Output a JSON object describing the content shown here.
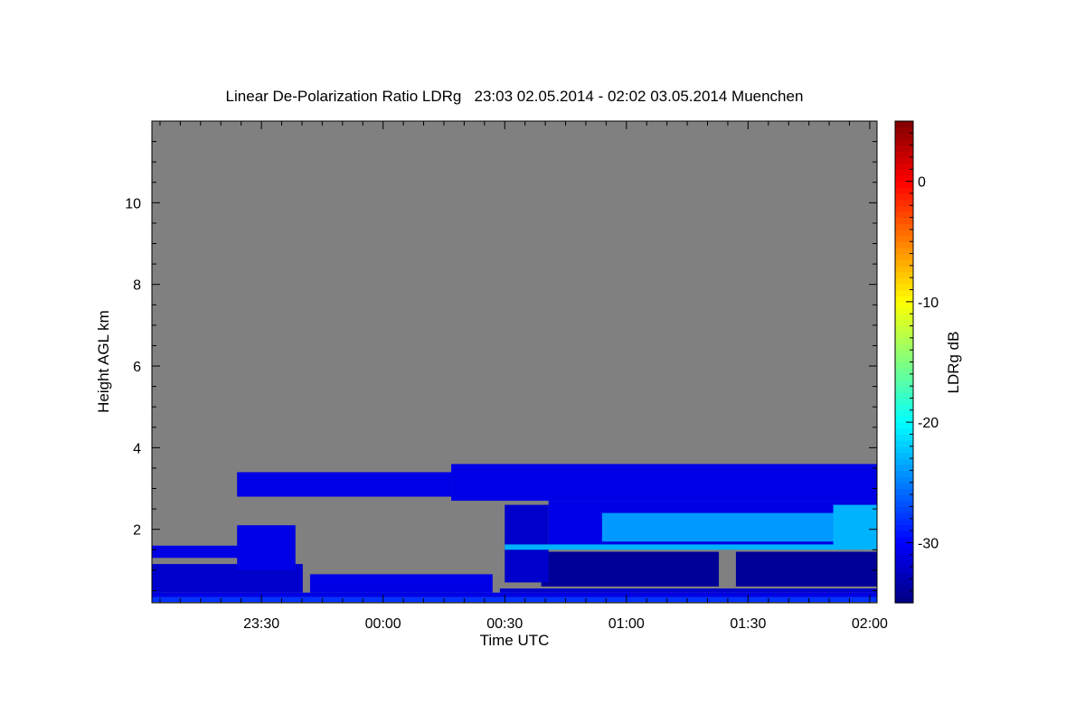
{
  "chart_data": {
    "type": "heatmap",
    "title": "Linear De-Polarization Ratio LDRg   23:03 02.05.2014 - 02:02 03.05.2014 Muenchen",
    "xlabel": "Time UTC",
    "ylabel": "Height AGL km",
    "x_range_hours": [
      -0.95,
      2.03
    ],
    "y_range_km": [
      0.2,
      12.0
    ],
    "x_ticks": [
      {
        "label": "23:30",
        "value": -0.5
      },
      {
        "label": "00:00",
        "value": 0.0
      },
      {
        "label": "00:30",
        "value": 0.5
      },
      {
        "label": "01:00",
        "value": 1.0
      },
      {
        "label": "01:30",
        "value": 1.5
      },
      {
        "label": "02:00",
        "value": 2.0
      }
    ],
    "y_ticks": [
      {
        "label": "2",
        "value": 2
      },
      {
        "label": "4",
        "value": 4
      },
      {
        "label": "6",
        "value": 6
      },
      {
        "label": "8",
        "value": 8
      },
      {
        "label": "10",
        "value": 10
      }
    ],
    "colorbar": {
      "label": "LDRg dB",
      "range": [
        -35,
        5
      ],
      "ticks": [
        {
          "label": "0",
          "value": 0
        },
        {
          "label": "-10",
          "value": -10
        },
        {
          "label": "-20",
          "value": -20
        },
        {
          "label": "-30",
          "value": -30
        }
      ]
    },
    "no_signal_color": "#808080",
    "regions": [
      {
        "t0": -0.95,
        "t1": 2.03,
        "h0": 0.22,
        "h1": 0.34,
        "ldr": -28
      },
      {
        "t0": -0.95,
        "t1": 2.03,
        "h0": 0.34,
        "h1": 0.45,
        "ldr": -31
      },
      {
        "t0": -0.95,
        "t1": -0.33,
        "h0": 0.45,
        "h1": 1.15,
        "ldr": -32
      },
      {
        "t0": -0.6,
        "t1": -0.36,
        "h0": 1.0,
        "h1": 2.1,
        "ldr": -31
      },
      {
        "t0": -0.95,
        "t1": -0.55,
        "h0": 1.3,
        "h1": 1.6,
        "ldr": -31
      },
      {
        "t0": -0.3,
        "t1": 0.45,
        "h0": 0.45,
        "h1": 0.9,
        "ldr": -31
      },
      {
        "t0": 0.48,
        "t1": 2.03,
        "h0": 0.45,
        "h1": 0.55,
        "ldr": -32
      },
      {
        "t0": 0.65,
        "t1": 1.38,
        "h0": 0.6,
        "h1": 1.45,
        "ldr": -34
      },
      {
        "t0": 1.45,
        "t1": 2.03,
        "h0": 0.6,
        "h1": 1.45,
        "ldr": -34
      },
      {
        "t0": 0.5,
        "t1": 0.68,
        "h0": 0.7,
        "h1": 2.6,
        "ldr": -32
      },
      {
        "t0": 0.68,
        "t1": 2.03,
        "h0": 1.55,
        "h1": 2.7,
        "ldr": -31
      },
      {
        "t0": 0.9,
        "t1": 1.9,
        "h0": 1.7,
        "h1": 2.4,
        "ldr": -24
      },
      {
        "t0": 1.85,
        "t1": 2.03,
        "h0": 1.6,
        "h1": 2.6,
        "ldr": -23
      },
      {
        "t0": 0.5,
        "t1": 2.03,
        "h0": 1.5,
        "h1": 1.63,
        "ldr": -23
      },
      {
        "t0": 0.28,
        "t1": 2.03,
        "h0": 2.7,
        "h1": 3.6,
        "ldr": -31
      },
      {
        "t0": -0.6,
        "t1": 0.28,
        "h0": 2.8,
        "h1": 3.4,
        "ldr": -31
      }
    ]
  }
}
